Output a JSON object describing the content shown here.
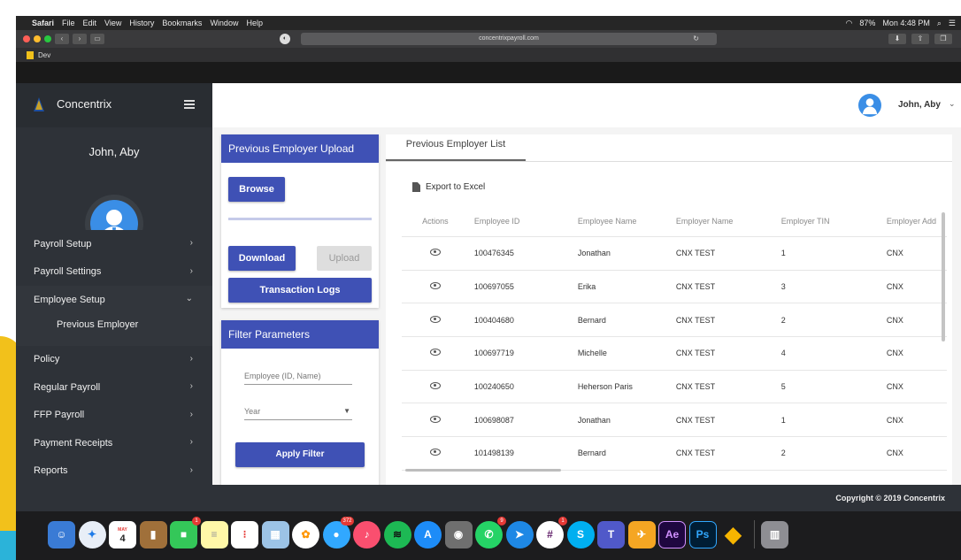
{
  "menubar": {
    "apple": "",
    "items": [
      "Safari",
      "File",
      "Edit",
      "View",
      "History",
      "Bookmarks",
      "Window",
      "Help"
    ],
    "battery": "87%",
    "clock": "Mon 4:48 PM"
  },
  "browser": {
    "url": "concentrixpayroll.com",
    "favorites": [
      "Dev"
    ]
  },
  "app": {
    "brand": "Concentrix",
    "user_name": "John, Aby",
    "nav": [
      {
        "label": "Payroll Setup"
      },
      {
        "label": "Payroll Settings"
      },
      {
        "label": "Employee Setup",
        "sub": "Previous Employer"
      },
      {
        "label": "Policy"
      },
      {
        "label": "Regular Payroll"
      },
      {
        "label": "FFP Payroll"
      },
      {
        "label": "Payment Receipts"
      },
      {
        "label": "Reports"
      }
    ],
    "upload_panel": {
      "title": "Previous Employer Upload",
      "browse": "Browse",
      "download": "Download",
      "upload": "Upload",
      "transaction_logs": "Transaction Logs",
      "progress": 0
    },
    "filter_panel": {
      "title": "Filter Parameters",
      "employee_placeholder": "Employee (ID, Name)",
      "year_placeholder": "Year",
      "apply": "Apply Filter"
    },
    "list": {
      "tab": "Previous Employer List",
      "export": "Export to Excel",
      "columns": [
        "Actions",
        "Employee ID",
        "Employee Name",
        "Employer Name",
        "Employer TIN",
        "Employer Add"
      ],
      "rows": [
        {
          "id": "100476345",
          "name": "Jonathan",
          "employer": "CNX TEST",
          "tin": "1",
          "address": "CNX"
        },
        {
          "id": "100697055",
          "name": "Erika",
          "employer": "CNX TEST",
          "tin": "3",
          "address": "CNX"
        },
        {
          "id": "100404680",
          "name": "Bernard",
          "employer": "CNX TEST",
          "tin": "2",
          "address": "CNX"
        },
        {
          "id": "100697719",
          "name": "Michelle",
          "employer": "CNX TEST",
          "tin": "4",
          "address": "CNX"
        },
        {
          "id": "100240650",
          "name": "Heherson Paris",
          "employer": "CNX TEST",
          "tin": "5",
          "address": "CNX"
        },
        {
          "id": "100698087",
          "name": "Jonathan",
          "employer": "CNX TEST",
          "tin": "1",
          "address": "CNX"
        },
        {
          "id": "101498139",
          "name": "Bernard",
          "employer": "CNX TEST",
          "tin": "2",
          "address": "CNX"
        }
      ]
    },
    "footer": "Copyright © 2019 Concentrix"
  },
  "dock": {
    "calendar_month": "MAY",
    "calendar_day": "4",
    "badges": {
      "facetime": "1",
      "messages": "372",
      "whatsapp": "9",
      "slack": "1"
    },
    "ae": "Ae",
    "ps": "Ps"
  },
  "colors": {
    "primary": "#3f51b5",
    "sidebar": "#2e3238",
    "avatar": "#3a8ee6"
  }
}
